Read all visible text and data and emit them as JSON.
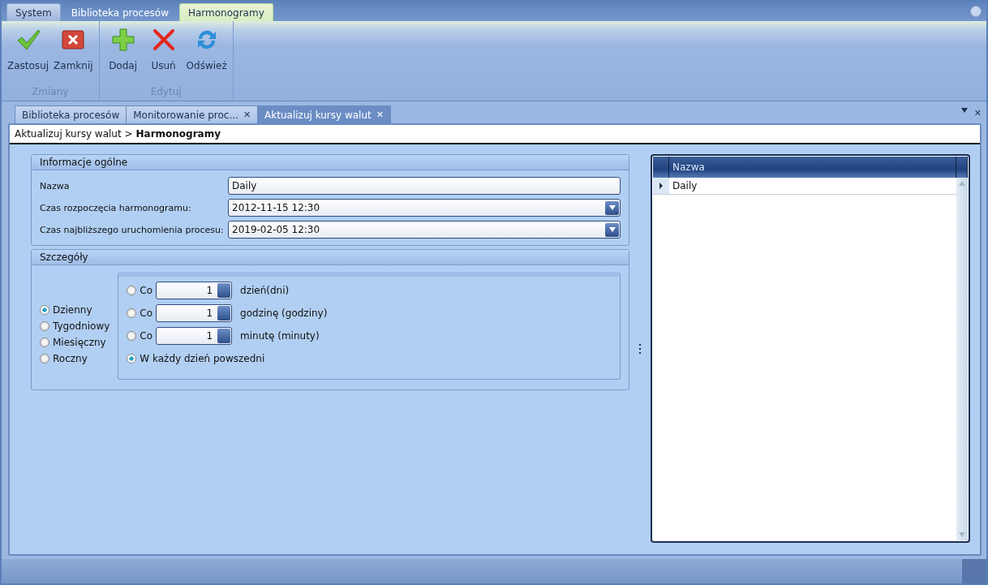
{
  "ribbon_tabs": [
    {
      "label": "System",
      "selected": false,
      "kind": "app"
    },
    {
      "label": "Biblioteka procesów",
      "selected": false,
      "kind": "normal"
    },
    {
      "label": "Harmonogramy",
      "selected": true,
      "kind": "normal"
    }
  ],
  "ribbon_groups": [
    {
      "label": "Zmiany",
      "buttons": [
        {
          "label": "Zastosuj"
        },
        {
          "label": "Zamknij"
        }
      ]
    },
    {
      "label": "Edytuj",
      "buttons": [
        {
          "label": "Dodaj"
        },
        {
          "label": "Usuń"
        },
        {
          "label": "Odśwież"
        }
      ]
    }
  ],
  "document_tabs": [
    {
      "label": "Biblioteka procesów",
      "selected": false
    },
    {
      "label": "Monitorowanie proc...",
      "selected": false,
      "close": "✕"
    },
    {
      "label": "Aktualizuj kursy walut",
      "selected": true,
      "close": "✕"
    }
  ],
  "document_close": "✕",
  "breadcrumb": {
    "path": "Aktualizuj kursy walut >",
    "current": "Harmonogramy"
  },
  "general": {
    "title": "Informacje ogólne",
    "fields": [
      {
        "label": "Nazwa",
        "value": "Daily",
        "kind": "text"
      },
      {
        "label": "Czas rozpoczęcia harmonogramu:",
        "value": "2012-11-15 12:30",
        "kind": "dropdown"
      },
      {
        "label": "Czas najbliższego uruchomienia procesu:",
        "value": "2019-02-05 12:30",
        "kind": "dropdown"
      }
    ]
  },
  "details": {
    "title": "Szczegóły",
    "frequencies": [
      {
        "label": "Dzienny",
        "selected": true
      },
      {
        "label": "Tygodniowy",
        "selected": false
      },
      {
        "label": "Miesięczny",
        "selected": false
      },
      {
        "label": "Roczny",
        "selected": false
      }
    ],
    "options": [
      {
        "kind": "interval",
        "prefix": "Co",
        "value": "1",
        "unit": "dzień(dni)",
        "selected": false
      },
      {
        "kind": "interval",
        "prefix": "Co",
        "value": "1",
        "unit": "godzinę (godziny)",
        "selected": false
      },
      {
        "kind": "interval",
        "prefix": "Co",
        "value": "1",
        "unit": "minutę (minuty)",
        "selected": false
      },
      {
        "kind": "plain",
        "label": "W każdy dzień powszedni",
        "selected": true
      }
    ]
  },
  "grid": {
    "columns": [
      "Nazwa"
    ],
    "rows": [
      {
        "cells": [
          "Daily"
        ],
        "selected": true
      }
    ]
  }
}
